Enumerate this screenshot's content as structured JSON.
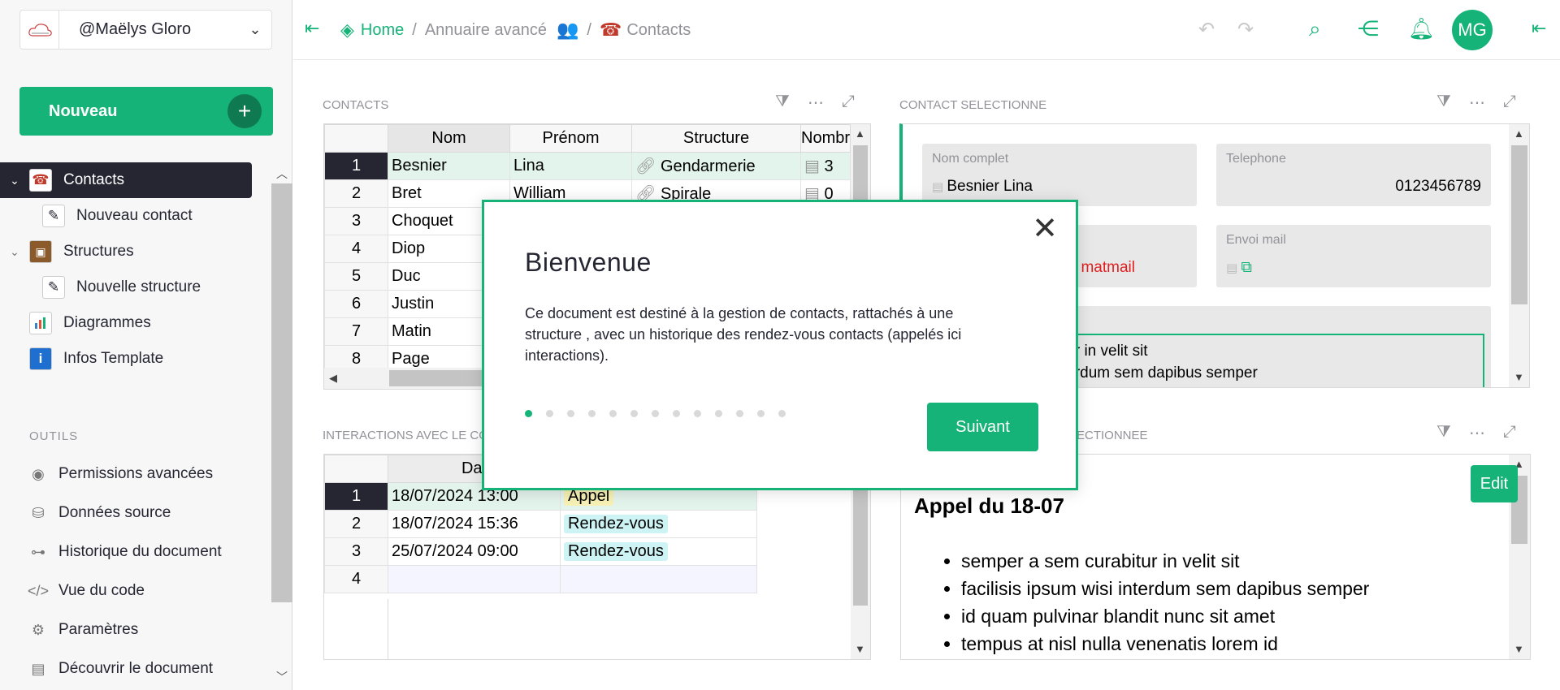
{
  "sidebar": {
    "org_name": "@Maëlys Gloro",
    "new_button": "Nouveau",
    "pages": [
      {
        "label": "Contacts",
        "icon": "☎"
      },
      {
        "label": "Nouveau contact",
        "icon": "📝"
      },
      {
        "label": "Structures",
        "icon": "💼"
      },
      {
        "label": "Nouvelle structure",
        "icon": "📝"
      },
      {
        "label": "Diagrammes",
        "icon": "📊"
      },
      {
        "label": "Infos Template",
        "icon": "ℹ"
      }
    ],
    "tools_title": "OUTILS",
    "tools": [
      {
        "label": "Permissions avancées"
      },
      {
        "label": "Données source"
      },
      {
        "label": "Historique du document"
      },
      {
        "label": "Vue du code"
      },
      {
        "label": "Paramètres"
      },
      {
        "label": "Découvrir le document"
      }
    ]
  },
  "topbar": {
    "breadcrumb": {
      "home": "Home",
      "doc": "Annuaire avancé",
      "page": "Contacts"
    },
    "avatar_initials": "MG"
  },
  "contacts": {
    "title": "CONTACTS",
    "columns": [
      "Nom",
      "Prénom",
      "Structure",
      "Nombr"
    ],
    "rows": [
      {
        "n": "1",
        "nom": "Besnier",
        "prenom": "Lina",
        "structure": "Gendarmerie",
        "nombre": "3"
      },
      {
        "n": "2",
        "nom": "Bret",
        "prenom": "William",
        "structure": "Spirale",
        "nombre": "0"
      },
      {
        "n": "3",
        "nom": "Choquet",
        "prenom": "",
        "structure": "",
        "nombre": ""
      },
      {
        "n": "4",
        "nom": "Diop",
        "prenom": "",
        "structure": "",
        "nombre": ""
      },
      {
        "n": "5",
        "nom": "Duc",
        "prenom": "",
        "structure": "",
        "nombre": ""
      },
      {
        "n": "6",
        "nom": "Justin",
        "prenom": "",
        "structure": "",
        "nombre": ""
      },
      {
        "n": "7",
        "nom": "Matin",
        "prenom": "",
        "structure": "",
        "nombre": ""
      },
      {
        "n": "8",
        "nom": "Page",
        "prenom": "",
        "structure": "",
        "nombre": ""
      }
    ]
  },
  "interactions": {
    "title": "INTERACTIONS AVEC LE CO",
    "columns": [
      "Dat",
      ""
    ],
    "rows": [
      {
        "n": "1",
        "date": "18/07/2024 13:00",
        "type": "Appel"
      },
      {
        "n": "2",
        "date": "18/07/2024 15:36",
        "type": "Rendez-vous"
      },
      {
        "n": "3",
        "date": "25/07/2024 09:00",
        "type": "Rendez-vous"
      },
      {
        "n": "4",
        "date": "",
        "type": ""
      }
    ]
  },
  "contact_card": {
    "title": "CONTACT SELECTIONNE",
    "nom_complet_label": "Nom complet",
    "nom_complet": "Besnier Lina",
    "telephone_label": "Telephone",
    "telephone": "0123456789",
    "email_partial": "matmail",
    "envoi_mail_label": "Envoi mail",
    "notes_line1": "tur in velit sit",
    "notes_line2": "terdum sem dapibus semper"
  },
  "interaction_card": {
    "title": "ECTIONNEE",
    "edit_label": "Edit",
    "heading": "Appel du 18-07",
    "bullets": [
      "semper a sem curabitur in velit sit",
      "facilisis ipsum wisi interdum sem dapibus semper",
      "id quam pulvinar blandit nunc sit amet",
      "tempus at nisl nulla venenatis lorem id"
    ]
  },
  "modal": {
    "title": "Bienvenue",
    "body": "Ce document est destiné à la gestion de contacts, rattachés à une structure , avec un historique des rendez-vous contacts (appelés ici interactions).",
    "next_label": "Suivant",
    "dots_total": 13,
    "dots_active": 1
  },
  "colors": {
    "accent": "#16b378",
    "dark": "#262633",
    "muted": "#929299"
  }
}
